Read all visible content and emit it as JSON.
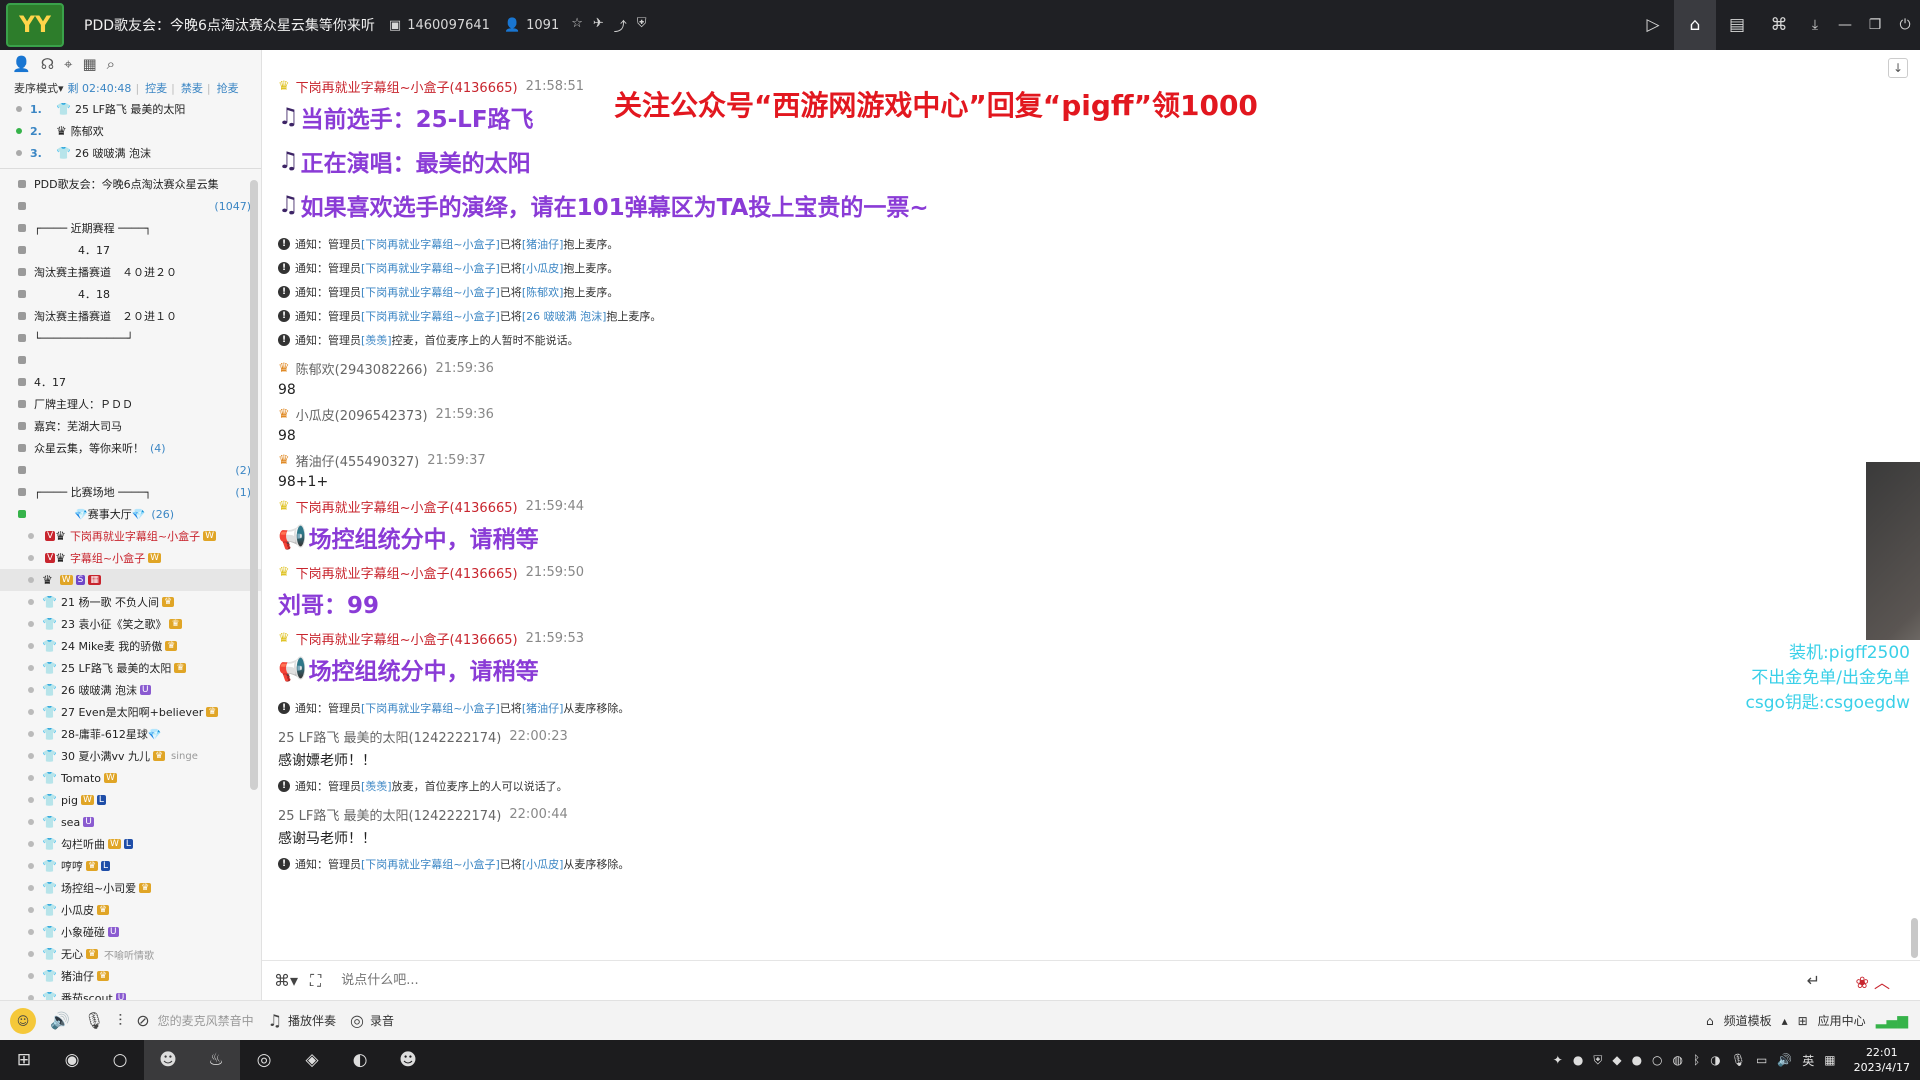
{
  "titlebar": {
    "room_title": "PDD歌友会：今晚6点淘汰赛众星云集等你来听",
    "room_id": "1460097641",
    "online": "1091",
    "logo_text": "YY"
  },
  "sidebar": {
    "mode": "麦序模式",
    "timer": "剩 02:40:48",
    "actions": [
      "控麦",
      "禁麦",
      "抢麦"
    ],
    "queue": [
      {
        "num": "1.",
        "name": "25 LF路飞 最美的太阳"
      },
      {
        "num": "2.",
        "name": "陈郁欢"
      },
      {
        "num": "3.",
        "name": "26 啵啵满 泡沫"
      }
    ],
    "channel_header": "PDD歌友会：今晚6点淘汰赛众星云集",
    "channel_header_count": "(1047)",
    "channels": [
      {
        "text": "┌──── 近期赛程 ────┐"
      },
      {
        "text": "　　　　4．17"
      },
      {
        "text": "淘汰赛主播赛道　４０进２０"
      },
      {
        "text": "　　　　4．18"
      },
      {
        "text": "淘汰赛主播赛道　２０进１０"
      },
      {
        "text": "└─────────────┘"
      },
      {
        "text": ""
      },
      {
        "text": "4．17"
      },
      {
        "text": "厂牌主理人：ＰＤＤ"
      },
      {
        "text": "嘉宾：芜湖大司马"
      },
      {
        "text": "众星云集，等你来听！",
        "count": "(4)"
      },
      {
        "text": "",
        "count": "(2)"
      },
      {
        "text": "┌──── 比赛场地 ────┐",
        "count": "(1)"
      }
    ],
    "hall": {
      "name": "赛事大厅",
      "count": "(26)"
    },
    "members": [
      {
        "name": "下岗再就业字幕组~小盒子",
        "red": true
      },
      {
        "name": "字幕组~小盒子",
        "red": true
      },
      {
        "name": "",
        "selected": true
      },
      {
        "name": "21 杨一歌 不负人间"
      },
      {
        "name": "23 袁小征《笑之歌》"
      },
      {
        "name": "24 Mike麦 我的骄傲"
      },
      {
        "name": "25 LF路飞 最美的太阳"
      },
      {
        "name": "26 啵啵满 泡沫"
      },
      {
        "name": "27 Even是太阳啊+believer"
      },
      {
        "name": "28-庸菲-612星球"
      },
      {
        "name": "30 夏小满vv 九儿",
        "tag": "singe"
      },
      {
        "name": "Tomato"
      },
      {
        "name": "pig"
      },
      {
        "name": "sea"
      },
      {
        "name": "勾栏听曲"
      },
      {
        "name": "哼哼"
      },
      {
        "name": "场控组~小司爱"
      },
      {
        "name": "小瓜皮"
      },
      {
        "name": "小象碰碰"
      },
      {
        "name": "无心",
        "tag": "不喻听情歌"
      },
      {
        "name": "猪油仔"
      },
      {
        "name": "番茄scout"
      }
    ]
  },
  "banner": "关注公众号“西游网游戏中心”回复“pigff”领1000",
  "chat": {
    "messages": [
      {
        "kind": "head",
        "user": "下岗再就业字幕组~小盒子(4136665)",
        "time": "21:58:51"
      },
      {
        "kind": "big",
        "text": "当前选手：25-LF路飞",
        "icon": "♫"
      },
      {
        "kind": "big",
        "text": "正在演唱：最美的太阳",
        "icon": "♫"
      },
      {
        "kind": "big",
        "text": "如果喜欢选手的演绎，请在101弹幕区为TA投上宝贵的一票~",
        "icon": "♫"
      },
      {
        "kind": "notice",
        "pre": "通知：管理员 ",
        "link": "[下岗再就业字幕组~小盒子]",
        "mid": " 已将 ",
        "link2": "[猪油仔]",
        "post": " 抱上麦序。"
      },
      {
        "kind": "notice",
        "pre": "通知：管理员 ",
        "link": "[下岗再就业字幕组~小盒子]",
        "mid": " 已将 ",
        "link2": "[小瓜皮]",
        "post": " 抱上麦序。"
      },
      {
        "kind": "notice",
        "pre": "通知：管理员 ",
        "link": "[下岗再就业字幕组~小盒子]",
        "mid": " 已将 ",
        "link2": "[陈郁欢]",
        "post": " 抱上麦序。"
      },
      {
        "kind": "notice",
        "pre": "通知：管理员 ",
        "link": "[下岗再就业字幕组~小盒子]",
        "mid": " 已将 ",
        "link2": "[26 啵啵满 泡沫]",
        "post": " 抱上麦序。"
      },
      {
        "kind": "notice",
        "pre": "通知：管理员 ",
        "link": "[羡羡]",
        "mid": " 控麦，首位麦序上的人暂时不能说话。",
        "link2": "",
        "post": ""
      },
      {
        "kind": "head",
        "user": "陈郁欢(2943082266)",
        "time": "21:59:36",
        "gray": true
      },
      {
        "kind": "text",
        "text": "98"
      },
      {
        "kind": "head",
        "user": "小瓜皮(2096542373)",
        "time": "21:59:36",
        "gray": true
      },
      {
        "kind": "text",
        "text": "98"
      },
      {
        "kind": "head",
        "user": "猪油仔(455490327)",
        "time": "21:59:37",
        "gray": true
      },
      {
        "kind": "text",
        "text": "98+1+"
      },
      {
        "kind": "head",
        "user": "下岗再就业字幕组~小盒子(4136665)",
        "time": "21:59:44"
      },
      {
        "kind": "big",
        "text": "场控组统分中，请稍等",
        "icon": "📢"
      },
      {
        "kind": "head",
        "user": "下岗再就业字幕组~小盒子(4136665)",
        "time": "21:59:50"
      },
      {
        "kind": "big",
        "text": "刘哥：99",
        "icon": ""
      },
      {
        "kind": "head",
        "user": "下岗再就业字幕组~小盒子(4136665)",
        "time": "21:59:53"
      },
      {
        "kind": "big",
        "text": "场控组统分中，请稍等",
        "icon": "📢"
      },
      {
        "kind": "notice",
        "pre": "通知：管理员 ",
        "link": "[下岗再就业字幕组~小盒子]",
        "mid": " 已将 ",
        "link2": "[猪油仔]",
        "post": " 从麦序移除。"
      },
      {
        "kind": "head",
        "user": "25 LF路飞 最美的太阳(1242222174)",
        "time": "22:00:23",
        "gray": true
      },
      {
        "kind": "text",
        "text": "感谢嫖老师！！"
      },
      {
        "kind": "notice",
        "pre": "通知：管理员 ",
        "link": "[羡羡]",
        "mid": " 放麦，首位麦序上的人可以说话了。",
        "link2": "",
        "post": ""
      },
      {
        "kind": "head",
        "user": "25 LF路飞 最美的太阳(1242222174)",
        "time": "22:00:44",
        "gray": true
      },
      {
        "kind": "text",
        "text": "感谢马老师！！"
      },
      {
        "kind": "notice",
        "pre": "通知：管理员 ",
        "link": "[下岗再就业字幕组~小盒子]",
        "mid": " 已将 ",
        "link2": "[小瓜皮]",
        "post": " 从麦序移除。"
      }
    ]
  },
  "overlay": {
    "lines": [
      "装机:pigff2500",
      "不出金免单/出金免单",
      "csgo钥匙:csgoegdw"
    ]
  },
  "input": {
    "placeholder": "说点什么吧..."
  },
  "bottombar": {
    "mic_hint": "您的麦克风禁音中",
    "accompany": "播放伴奏",
    "record": "录音",
    "template": "频道模板",
    "app_center": "应用中心"
  },
  "taskbar": {
    "ime": "英",
    "time": "22:01",
    "date": "2023/4/17"
  },
  "colors": {
    "admin_red": "#c8252e",
    "link_blue": "#3b86c4",
    "announce_purple": "#8a3bd6",
    "banner_red": "#e2171f",
    "overlay_cyan": "#3ad0e8"
  }
}
